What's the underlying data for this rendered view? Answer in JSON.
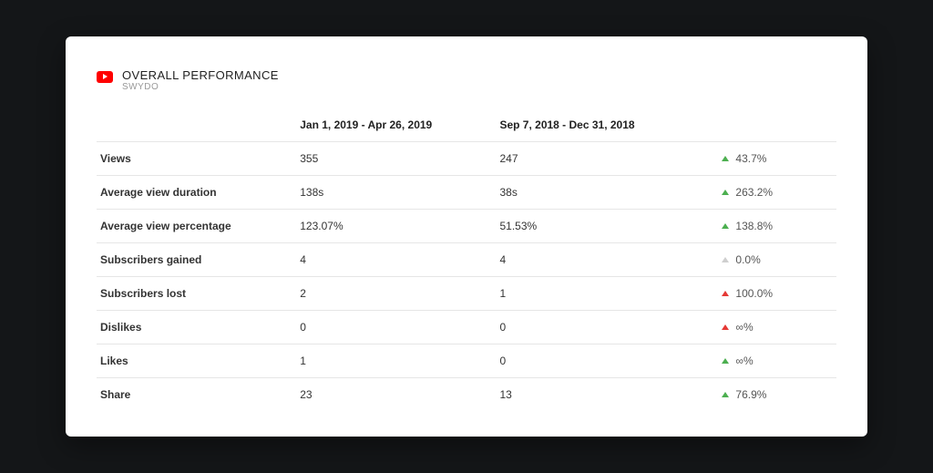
{
  "header": {
    "title": "OVERALL PERFORMANCE",
    "subtitle": "SWYDO",
    "icon": "youtube-icon"
  },
  "columns": {
    "metric": "",
    "period1": "Jan 1, 2019 - Apr 26, 2019",
    "period2": "Sep 7, 2018 - Dec 31, 2018",
    "delta": ""
  },
  "rows": [
    {
      "metric": "Views",
      "period1": "355",
      "period2": "247",
      "delta": "43.7%",
      "dir": "up",
      "color": "green"
    },
    {
      "metric": "Average view duration",
      "period1": "138s",
      "period2": "38s",
      "delta": "263.2%",
      "dir": "up",
      "color": "green"
    },
    {
      "metric": "Average view percentage",
      "period1": "123.07%",
      "period2": "51.53%",
      "delta": "138.8%",
      "dir": "up",
      "color": "green"
    },
    {
      "metric": "Subscribers gained",
      "period1": "4",
      "period2": "4",
      "delta": "0.0%",
      "dir": "up",
      "color": "gray"
    },
    {
      "metric": "Subscribers lost",
      "period1": "2",
      "period2": "1",
      "delta": "100.0%",
      "dir": "up",
      "color": "red"
    },
    {
      "metric": "Dislikes",
      "period1": "0",
      "period2": "0",
      "delta": "∞%",
      "dir": "up",
      "color": "red"
    },
    {
      "metric": "Likes",
      "period1": "1",
      "period2": "0",
      "delta": "∞%",
      "dir": "up",
      "color": "green"
    },
    {
      "metric": "Share",
      "period1": "23",
      "period2": "13",
      "delta": "76.9%",
      "dir": "up",
      "color": "green"
    }
  ]
}
